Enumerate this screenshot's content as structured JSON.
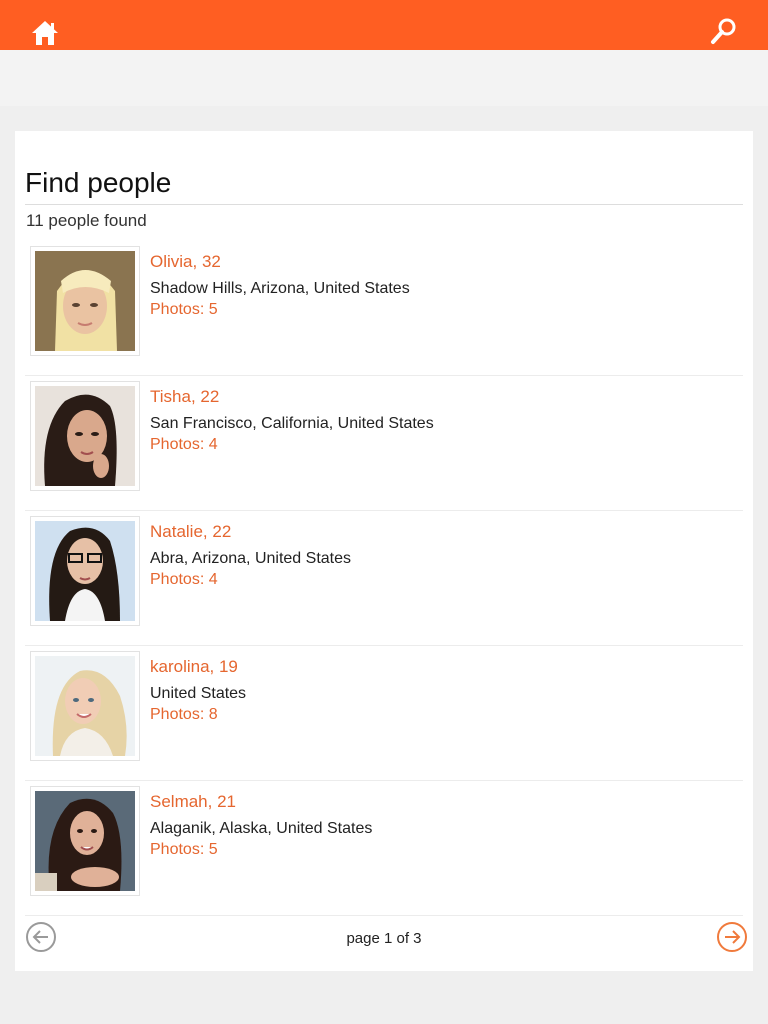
{
  "header": {
    "home_icon": "home-icon",
    "search_icon": "search-icon",
    "accent_color": "#ff5e22"
  },
  "main": {
    "title": "Find people",
    "count_text": "11 people found"
  },
  "people": [
    {
      "name": "Olivia, 32",
      "location": "Shadow Hills, Arizona, United States",
      "photos": "Photos: 5"
    },
    {
      "name": "Tisha, 22",
      "location": "San Francisco, California, United States",
      "photos": "Photos: 4"
    },
    {
      "name": "Natalie, 22",
      "location": "Abra, Arizona, United States",
      "photos": "Photos: 4"
    },
    {
      "name": "karolina, 19",
      "location": "United States",
      "photos": "Photos: 8"
    },
    {
      "name": "Selmah, 21",
      "location": "Alaganik, Alaska, United States",
      "photos": "Photos: 5"
    }
  ],
  "pager": {
    "label": "page 1 of 3",
    "prev_icon": "arrow-left-circle-icon",
    "next_icon": "arrow-right-circle-icon"
  }
}
